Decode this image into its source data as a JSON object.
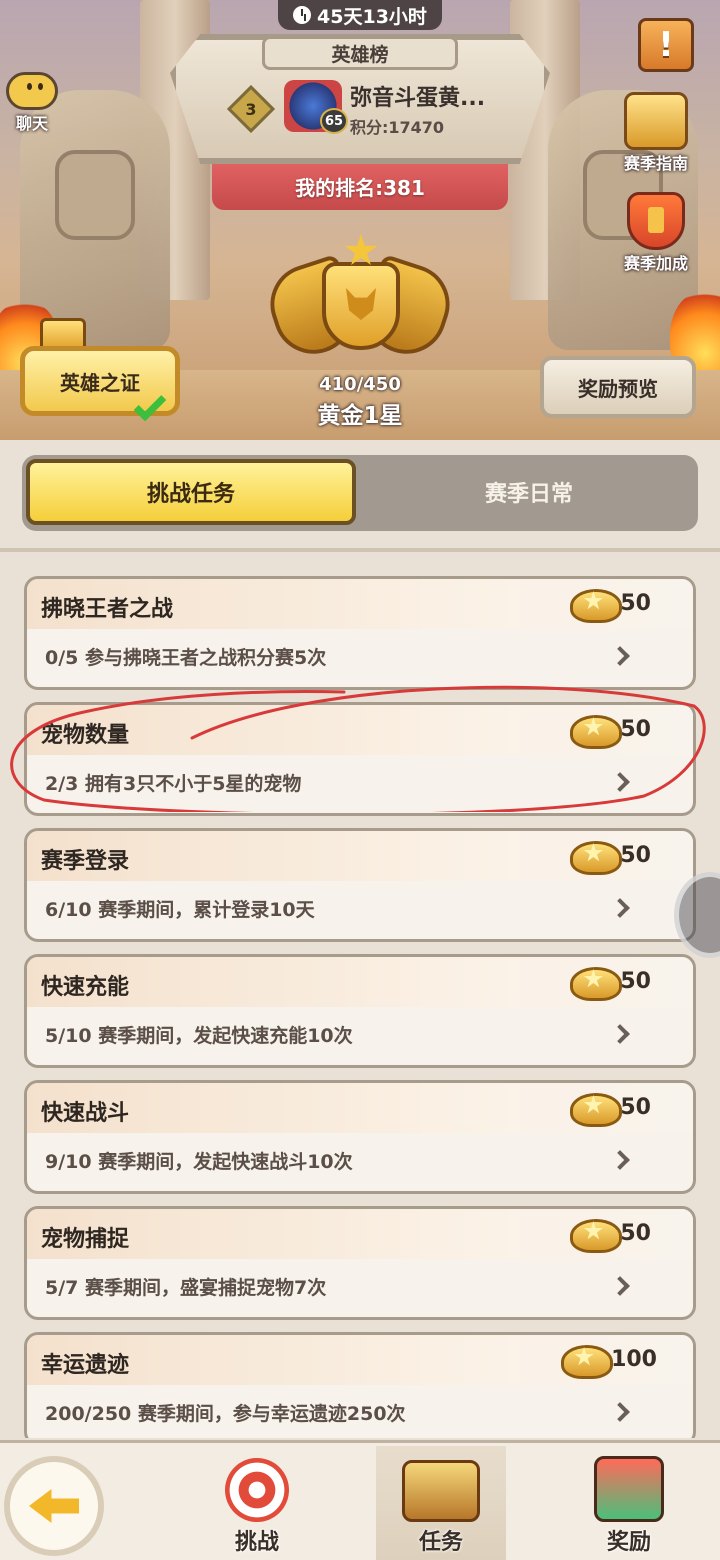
{
  "header": {
    "timer": "45天13小时",
    "board_title": "英雄榜",
    "rank_number": "3",
    "player_level": "65",
    "player_name": "弥音斗蛋黄...",
    "player_score": "积分:17470",
    "my_rank": "我的排名:381",
    "chat_label": "聊天",
    "menu_glyph": "!",
    "season_guide_label": "赛季指南",
    "season_bonus_label": "赛季加成",
    "proof_label": "英雄之证",
    "preview_label": "奖励预览",
    "progress": "410/450",
    "tier": "黄金1星"
  },
  "tabs": [
    {
      "label": "挑战任务",
      "selected": true
    },
    {
      "label": "赛季日常",
      "selected": false
    }
  ],
  "tasks": [
    {
      "title": "拂晓王者之战",
      "desc": "0/5  参与拂晓王者之战积分赛5次",
      "reward": "50"
    },
    {
      "title": "宠物数量",
      "desc": "2/3  拥有3只不小于5星的宠物",
      "reward": "50"
    },
    {
      "title": "赛季登录",
      "desc": "6/10  赛季期间，累计登录10天",
      "reward": "50"
    },
    {
      "title": "快速充能",
      "desc": "5/10  赛季期间，发起快速充能10次",
      "reward": "50"
    },
    {
      "title": "快速战斗",
      "desc": "9/10  赛季期间，发起快速战斗10次",
      "reward": "50"
    },
    {
      "title": "宠物捕捉",
      "desc": "5/7  赛季期间，盛宴捕捉宠物7次",
      "reward": "50"
    },
    {
      "title": "幸运遗迹",
      "desc": "200/250  赛季期间，参与幸运遗迹250次",
      "reward": "100"
    }
  ],
  "bottom_nav": {
    "challenge": "挑战",
    "task": "任务",
    "reward": "奖励"
  },
  "colors": {
    "accent": "#f5cf3a",
    "highlight": "#d83a3a"
  }
}
